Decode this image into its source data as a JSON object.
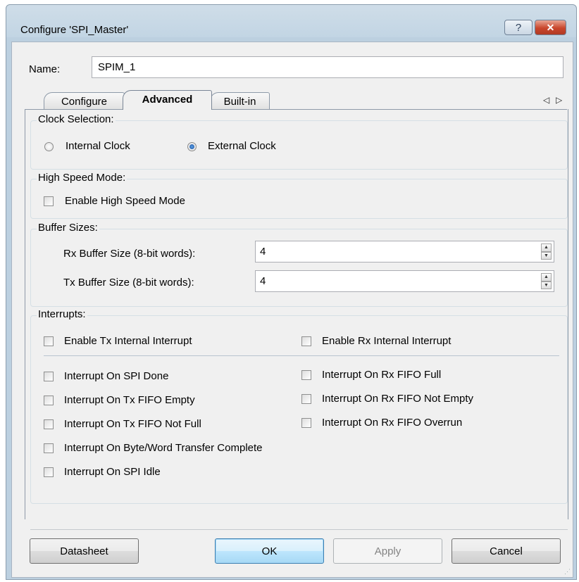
{
  "window": {
    "title": "Configure 'SPI_Master'"
  },
  "titlebar": {
    "help_glyph": "?",
    "close_glyph": "✕"
  },
  "name": {
    "label": "Name:",
    "value": "SPIM_1"
  },
  "tabs": [
    {
      "label": "Configure",
      "selected": false
    },
    {
      "label": "Advanced",
      "selected": true
    },
    {
      "label": "Built-in",
      "selected": false
    }
  ],
  "tab_scroll": {
    "left": "◁",
    "right": "▷"
  },
  "clock": {
    "title": "Clock Selection:",
    "internal_label": "Internal Clock",
    "external_label": "External Clock",
    "selected": "External Clock"
  },
  "high_speed": {
    "title": "High Speed Mode:",
    "enable_label": "Enable High Speed Mode",
    "checked": false
  },
  "buffers": {
    "title": "Buffer Sizes:",
    "rx_label": "Rx Buffer Size (8-bit words):",
    "rx_value": "4",
    "tx_label": "Tx Buffer Size (8-bit words):",
    "tx_value": "4"
  },
  "interrupts": {
    "title": "Interrupts:",
    "enable_tx": "Enable Tx Internal Interrupt",
    "enable_rx": "Enable Rx Internal Interrupt",
    "spi_done": "Interrupt On SPI Done",
    "tx_fifo_empty": "Interrupt On Tx FIFO Empty",
    "tx_fifo_not_full": "Interrupt On Tx FIFO Not Full",
    "byte_word_complete": "Interrupt On Byte/Word Transfer Complete",
    "spi_idle": "Interrupt On SPI Idle",
    "rx_fifo_full": "Interrupt On Rx FIFO Full",
    "rx_fifo_not_empty": "Interrupt On Rx FIFO Not Empty",
    "rx_fifo_overrun": "Interrupt On Rx FIFO Overrun"
  },
  "buttons": {
    "datasheet": "Datasheet",
    "ok": "OK",
    "apply": "Apply",
    "cancel": "Cancel"
  },
  "grip_glyph": "⋰"
}
